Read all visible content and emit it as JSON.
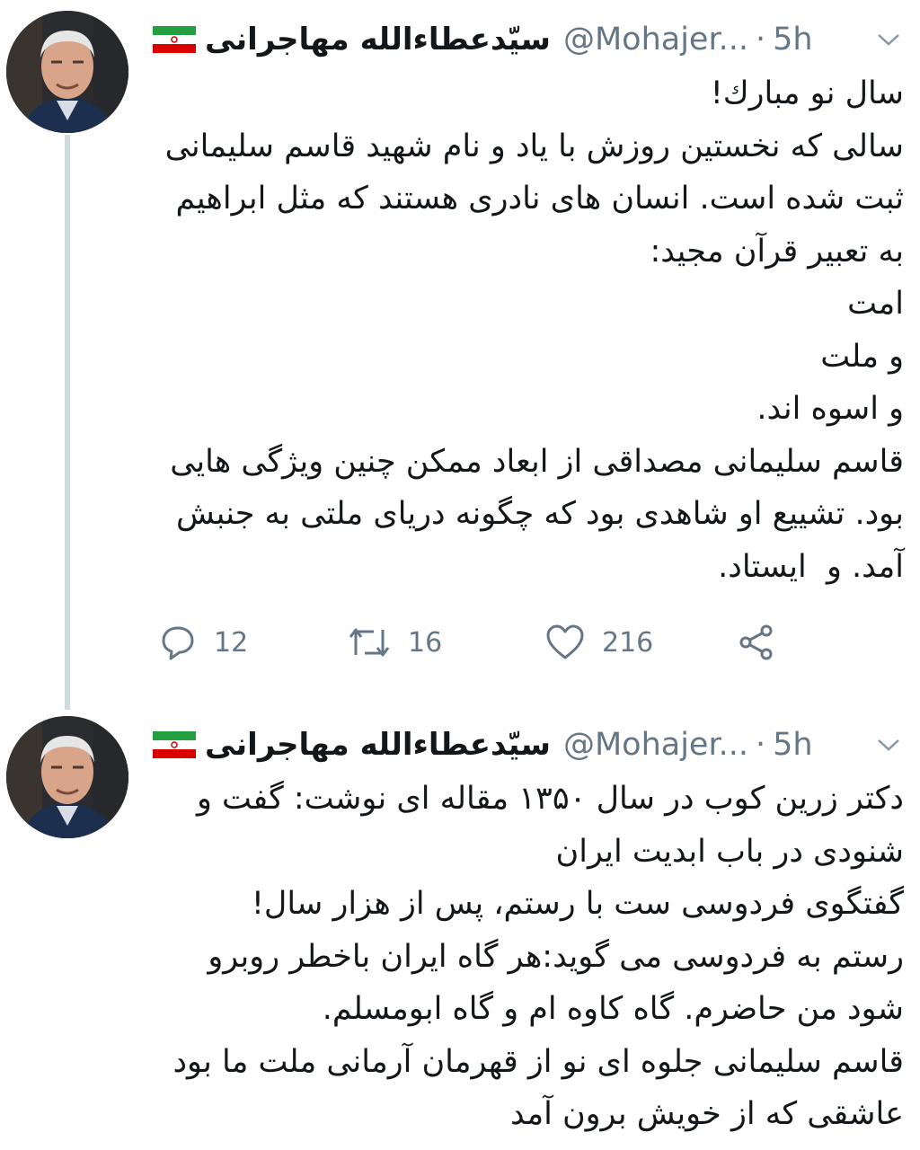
{
  "tweets": [
    {
      "author_name": "سیّدعطاءالله مهاجرانی",
      "handle": "@Mohajer...",
      "dot": "·",
      "time": "5h",
      "text": "سال نو مبارك!\nسالی که نخستین روزش با یاد و نام شهید قاسم سلیمانی ثبت شده است. انسان های نادری هستند که مثل ابراهیم به تعبیر قرآن مجید:\nامت\nو ملت\nو اسوه اند.\nقاسم سلیمانی مصداقی از ابعاد ممکن چنین ویژگی هایی بود. تشییع او شاهدی بود که چگونه دریای ملتی به جنبش آمد. و  ایستاد.",
      "replies": "12",
      "retweets": "16",
      "likes": "216"
    },
    {
      "author_name": "سیّدعطاءالله مهاجرانی",
      "handle": "@Mohajer...",
      "dot": "·",
      "time": "5h",
      "text": "دکتر زرین کوب در سال ۱۳۵۰ مقاله ای نوشت: گفت و شنودی در باب ابدیت ایران\nگفتگوی فردوسی ست با رستم، پس از هزار سال!\nرستم به فردوسی می گوید:هر گاه ایران باخطر روبرو شود من حاضرم. گاه کاوه ام و گاه ابومسلم.\nقاسم سلیمانی جلوه ای نو از قهرمان آرمانی ملت ما بود عاشقی که از خویش برون آمد"
    }
  ],
  "icons": {
    "avatar": "avatar-icon",
    "flag": "iran-flag-icon",
    "caret": "chevron-down-icon",
    "reply": "reply-icon",
    "retweet": "retweet-icon",
    "like": "heart-icon",
    "share": "share-icon"
  },
  "colors": {
    "text": "#14171a",
    "secondary": "#657786",
    "thread_line": "#cfd9de",
    "flag_green": "#239f40",
    "flag_red": "#da0000"
  }
}
